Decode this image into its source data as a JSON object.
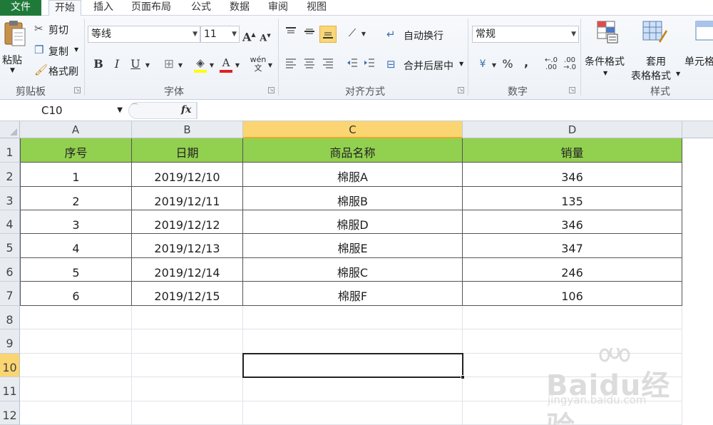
{
  "menu": {
    "file": "文件",
    "tabs": [
      "开始",
      "插入",
      "页面布局",
      "公式",
      "数据",
      "审阅",
      "视图"
    ]
  },
  "ribbon": {
    "clipboard": {
      "paste": "粘贴",
      "cut": "剪切",
      "copy": "复制",
      "format_painter": "格式刷",
      "label": "剪贴板"
    },
    "font": {
      "font_name": "等线",
      "font_size": "11",
      "bold": "B",
      "italic": "I",
      "underline": "U",
      "label": "字体"
    },
    "alignment": {
      "wrap_text": "自动换行",
      "merge_center": "合并后居中",
      "label": "对齐方式"
    },
    "number": {
      "format": "常规",
      "percent": "%",
      "comma": ",",
      "label": "数字"
    },
    "styles": {
      "conditional_format": "条件格式",
      "table_format_1": "套用",
      "table_format_2": "表格格式",
      "cell_styles": "单元格",
      "label": "样式"
    }
  },
  "formula_bar": {
    "name_box": "C10",
    "fx": "fx",
    "value": ""
  },
  "sheet": {
    "columns": [
      "A",
      "B",
      "C",
      "D"
    ],
    "selected_column": "C",
    "rows": [
      "1",
      "2",
      "3",
      "4",
      "5",
      "6",
      "7",
      "8",
      "9",
      "10",
      "11",
      "12"
    ],
    "selected_row": "10",
    "header": [
      "序号",
      "日期",
      "商品名称",
      "销量"
    ],
    "data": [
      [
        "1",
        "2019/12/10",
        "棉服A",
        "346"
      ],
      [
        "2",
        "2019/12/11",
        "棉服B",
        "135"
      ],
      [
        "3",
        "2019/12/12",
        "棉服D",
        "346"
      ],
      [
        "4",
        "2019/12/13",
        "棉服E",
        "347"
      ],
      [
        "5",
        "2019/12/14",
        "棉服C",
        "246"
      ],
      [
        "6",
        "2019/12/15",
        "棉服F",
        "106"
      ]
    ],
    "header_fill": "#92d050"
  },
  "watermark": {
    "logo": "Baidu经验",
    "url": "jingyan.baidu.com"
  }
}
